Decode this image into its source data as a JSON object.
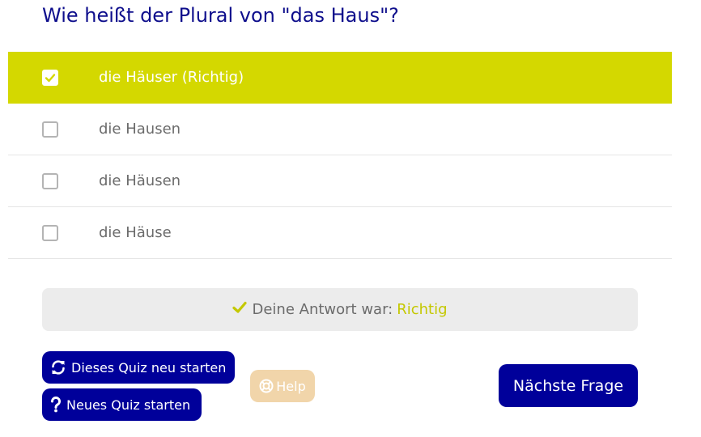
{
  "question": {
    "text": "Wie heißt der Plural von \"das Haus\"?"
  },
  "answers": [
    {
      "label": "die Häuser (Richtig)",
      "checked": true
    },
    {
      "label": "die Hausen",
      "checked": false
    },
    {
      "label": "die Häusen",
      "checked": false
    },
    {
      "label": "die Häuse",
      "checked": false
    }
  ],
  "result": {
    "icon": "check-icon",
    "prefix": "Deine Antwort war:",
    "value": "Richtig"
  },
  "buttons": {
    "restart_label": "Dieses Quiz neu starten",
    "restart_icon": "refresh-icon",
    "new_quiz_label": "Neues Quiz starten",
    "new_quiz_icon": "question-icon",
    "help_label": "Help",
    "help_icon": "lifebuoy-icon",
    "next_label": "Nächste Frage"
  },
  "colors": {
    "title": "#0e0e8c",
    "selected_row": "#d4d800",
    "correct_text": "#c4c800",
    "primary_button": "#00009a",
    "help_button": "#f1d5aa"
  }
}
